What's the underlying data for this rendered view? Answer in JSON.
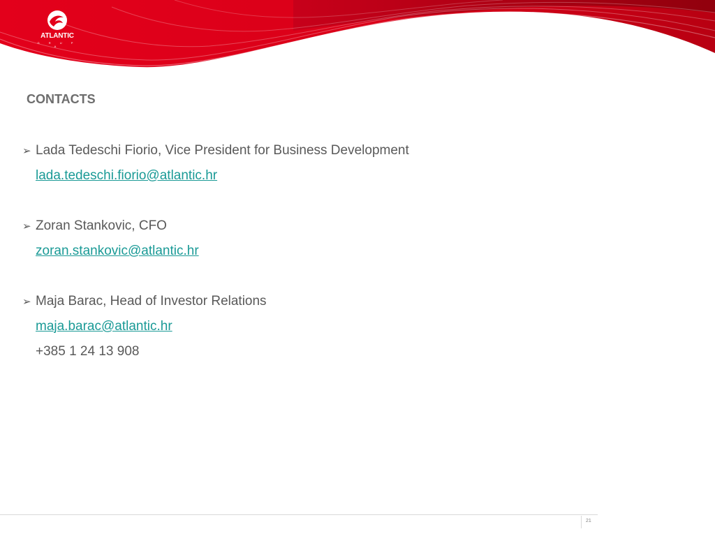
{
  "theme": {
    "brand_red": "#e3001b",
    "dark_red": "#b0000f",
    "text_grey": "#595959",
    "title_grey": "#6d6d6d",
    "link_teal": "#1a9a96"
  },
  "header": {
    "logo_text": "ATLANTIC",
    "logo_subtext": "G R U P A",
    "logo_icon": "atlantic-wave-icon"
  },
  "title": "CONTACTS",
  "bullet_icon": "➢",
  "contacts": [
    {
      "name_role": "Lada Tedeschi Fiorio, Vice President for Business Development",
      "email": "lada.tedeschi.fiorio@atlantic.hr"
    },
    {
      "name_role": "Zoran Stankovic, CFO",
      "email": "zoran.stankovic@atlantic.hr"
    },
    {
      "name_role": "Maja Barac, Head of Investor Relations",
      "email": "maja.barac@atlantic.hr",
      "phone": "+385 1 24 13 908"
    }
  ],
  "footer": {
    "page_number": "21"
  }
}
